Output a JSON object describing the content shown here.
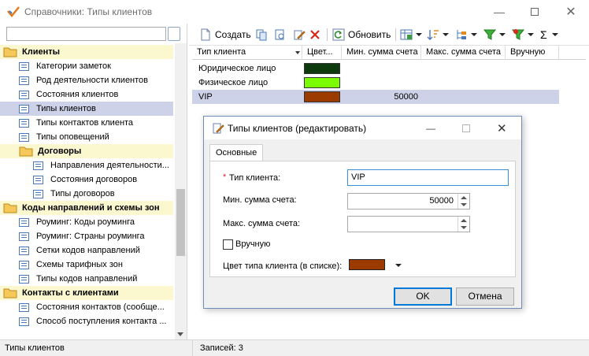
{
  "window": {
    "title": "Справочники: Типы клиентов"
  },
  "tree": {
    "items": [
      {
        "label": "Клиенты",
        "type": "folder",
        "indent": 0
      },
      {
        "label": "Категории заметок",
        "type": "item",
        "indent": 1
      },
      {
        "label": "Род деятельности клиентов",
        "type": "item",
        "indent": 1
      },
      {
        "label": "Состояния клиентов",
        "type": "item",
        "indent": 1
      },
      {
        "label": "Типы клиентов",
        "type": "item",
        "indent": 1,
        "selected": true
      },
      {
        "label": "Типы контактов клиента",
        "type": "item",
        "indent": 1
      },
      {
        "label": "Типы оповещений",
        "type": "item",
        "indent": 1
      },
      {
        "label": "Договоры",
        "type": "folder",
        "indent": 1
      },
      {
        "label": "Направления деятельности...",
        "type": "item",
        "indent": 2
      },
      {
        "label": "Состояния договоров",
        "type": "item",
        "indent": 2
      },
      {
        "label": "Типы договоров",
        "type": "item",
        "indent": 2
      },
      {
        "label": "Коды направлений и схемы зон",
        "type": "folder",
        "indent": 0
      },
      {
        "label": "Роуминг: Коды роуминга",
        "type": "item",
        "indent": 1
      },
      {
        "label": "Роуминг: Страны роуминга",
        "type": "item",
        "indent": 1
      },
      {
        "label": "Сетки кодов направлений",
        "type": "item",
        "indent": 1
      },
      {
        "label": "Схемы тарифных зон",
        "type": "item",
        "indent": 1
      },
      {
        "label": "Типы кодов направлений",
        "type": "item",
        "indent": 1
      },
      {
        "label": "Контакты с клиентами",
        "type": "folder",
        "indent": 0
      },
      {
        "label": "Состояния контактов (сообще...",
        "type": "item",
        "indent": 1
      },
      {
        "label": "Способ поступления контакта ...",
        "type": "item",
        "indent": 1
      }
    ]
  },
  "toolbar": {
    "create": "Создать",
    "refresh": "Обновить",
    "sum_icon": "Σ"
  },
  "grid": {
    "columns": [
      "Тип клиента",
      "Цвет...",
      "Мин. сумма счета",
      "Макс. сумма счета",
      "Вручную"
    ],
    "rows": [
      {
        "name": "Юридическое лицо",
        "color": "#0d3b0d",
        "min": "",
        "max": ""
      },
      {
        "name": "Физическое лицо",
        "color": "#7cfc00",
        "min": "",
        "max": ""
      },
      {
        "name": "VIP",
        "color": "#9b3b00",
        "min": "50000",
        "max": "",
        "selected": true
      }
    ]
  },
  "status": {
    "left": "Типы клиентов",
    "right": "Записей: 3"
  },
  "dialog": {
    "title": "Типы клиентов (редактировать)",
    "tab": "Основные",
    "type_label": "Тип клиента:",
    "required_mark": "*",
    "type_value": "VIP",
    "min_label": "Мин. сумма счета:",
    "min_value": "50000",
    "max_label": "Макс. сумма счета:",
    "max_value": "",
    "manual_label": "Вручную",
    "color_label": "Цвет типа клиента (в списке):",
    "color_value": "#9b3b00",
    "ok": "OK",
    "cancel": "Отмена"
  }
}
